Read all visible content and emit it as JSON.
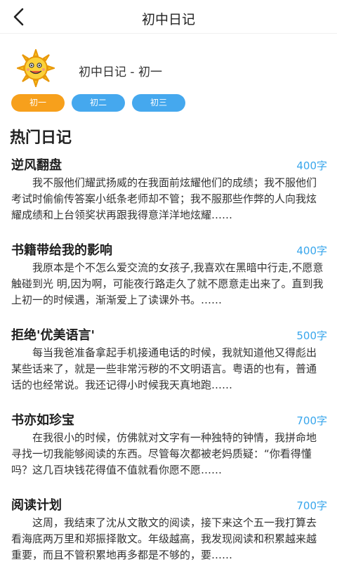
{
  "topbar": {
    "title": "初中日记",
    "back_icon": "chevron-left-icon"
  },
  "grade_header": {
    "title": "初中日记 - 初一",
    "logo_icon": "sun-mascot-icon"
  },
  "chips": [
    {
      "label": "初一",
      "active": true
    },
    {
      "label": "初二",
      "active": false
    },
    {
      "label": "初三",
      "active": false
    }
  ],
  "section_title": "热门日记",
  "entries": [
    {
      "title": "逆风翻盘",
      "count": "400字",
      "excerpt": "我不服他们耀武扬威的在我面前炫耀他们的成绩；我不服他们考试时偷偷传答案小纸条老师却不管；我不服那些作弊的人向我炫耀成绩和上台领奖状再跟我得意洋洋地炫耀……"
    },
    {
      "title": "书籍带给我的影响",
      "count": "400字",
      "excerpt": "我原本是个不怎么爱交流的女孩子,我喜欢在黑暗中行走,不愿意触碰到光 明,因为啊，可能夜行路走久了就不愿意走出来了。直到我上初一的时候遇，渐渐爱上了读课外书。……"
    },
    {
      "title": "拒绝'优美语言'",
      "count": "500字",
      "excerpt": "每当我爸准备拿起手机接通电话的时候，我就知道他又得彪出某些话来了，就是一些非常污秽的不文明语言。粤语的也有，普通话的也经常说。我还记得小时候我天真地跑……"
    },
    {
      "title": "书亦如珍宝",
      "count": "700字",
      "excerpt": "在我很小的时候，仿佛就对文字有一种独特的钟情，我拼命地寻找一切我能够阅读的东西。尽管每次都被老妈质疑：“你看得懂吗？这几百块钱花得值不值就看你愿不愿……"
    },
    {
      "title": "阅读计划",
      "count": "700字",
      "excerpt": "这周，我结束了沈从文散文的阅读，接下来这个五一我打算去看海底两万里和郑振择散文。年级越高，我发现阅读和积累越来越重要，而且不管积累地再多都是不够的，要……"
    }
  ]
}
